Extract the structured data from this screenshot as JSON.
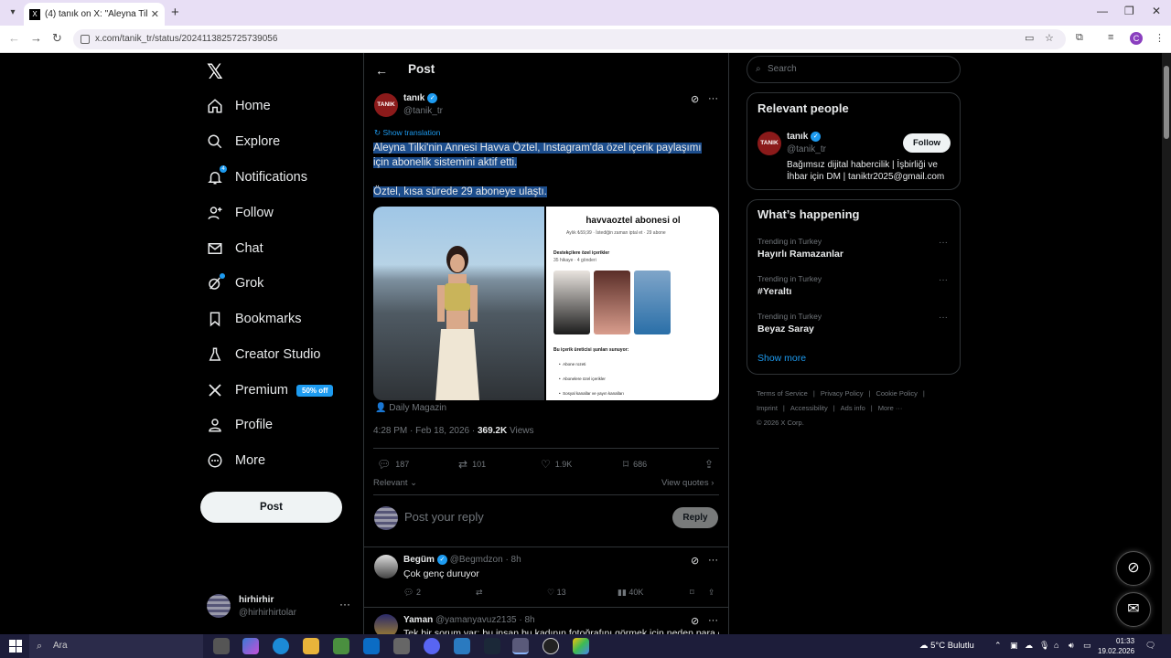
{
  "browser": {
    "tab_title": "(4) tanık on X: \"Aleyna Tilki'nin",
    "url": "x.com/tanik_tr/status/2024113825725739056"
  },
  "nav": {
    "items": [
      {
        "label": "Home",
        "icon": "home-icon"
      },
      {
        "label": "Explore",
        "icon": "search-icon"
      },
      {
        "label": "Notifications",
        "icon": "bell-icon",
        "badge": "4"
      },
      {
        "label": "Follow",
        "icon": "add-person-icon"
      },
      {
        "label": "Chat",
        "icon": "mail-icon"
      },
      {
        "label": "Grok",
        "icon": "grok-icon"
      },
      {
        "label": "Bookmarks",
        "icon": "bookmark-icon"
      },
      {
        "label": "Creator Studio",
        "icon": "creator-icon"
      },
      {
        "label": "Premium",
        "icon": "x-icon",
        "promo": "50% off"
      },
      {
        "label": "Profile",
        "icon": "person-icon"
      },
      {
        "label": "More",
        "icon": "more-circle-icon"
      }
    ],
    "post_button": "Post",
    "account_name": "hirhirhir",
    "account_handle": "@hirhirhirtolar"
  },
  "main": {
    "header": "Post",
    "author": {
      "avatar_text": "TANIK",
      "name": "tanık",
      "handle": "@tanik_tr"
    },
    "show_translation": "Show translation",
    "text_line1": "Aleyna Tilki'nin Annesi Havva Öztel, Instagram'da özel içerik paylaşımı için abonelik sistemini aktif etti.",
    "text_line2": "Öztel, kısa sürede 29 aboneye ulaştı.",
    "media": {
      "title": "havvaoztel abonesi ol",
      "subtitle": "Aylık ₺59,99 · İstediğin zaman iptal et · 29 abone",
      "section": "Destekçilere özel içerikler",
      "section_sub": "35 hikaye · 4 gönderi",
      "offers_title": "Bu içerik üreticisi şunları sunuyor:",
      "offers": [
        "Abone rozeti",
        "Abonelere özel içerikler",
        "Sosyal kanallar ve yayın kanalları"
      ]
    },
    "media_caption": "Daily Magazin",
    "time": "4:28 PM · Feb 18, 2026 · ",
    "views_count": "369.2K",
    "views_label": " Views",
    "stats": {
      "replies": "187",
      "reposts": "101",
      "likes": "1.9K",
      "bookmarks": "686"
    },
    "relevant": "Relevant",
    "view_quotes": "View quotes",
    "reply_placeholder": "Post your reply",
    "reply_button": "Reply",
    "comments": [
      {
        "name": "Begüm",
        "handle": "@Begmdzon",
        "time": "· 8h",
        "text": "Çok genç duruyor",
        "replies": "2",
        "likes": "13",
        "views": "40K"
      },
      {
        "name": "Yaman",
        "handle": "@yamanyavuz2135",
        "time": "· 8h",
        "text": "Tek bir sorum var: bu insan bu kadının fotoğrafını görmek için neden para öder?"
      }
    ]
  },
  "right": {
    "search_placeholder": "Search",
    "relevant_title": "Relevant people",
    "person": {
      "avatar_text": "TANIK",
      "name": "tanık",
      "handle": "@tanik_tr",
      "follow": "Follow",
      "bio": "Bağımsız dijital habercilik | İşbirliği ve İhbar için DM | taniktr2025@gmail.com"
    },
    "happening_title": "What’s happening",
    "trends": [
      {
        "category": "Trending in Turkey",
        "name": "Hayırlı Ramazanlar"
      },
      {
        "category": "Trending in Turkey",
        "name": "#Yeraltı"
      },
      {
        "category": "Trending in Turkey",
        "name": "Beyaz Saray"
      }
    ],
    "show_more": "Show more",
    "footer": [
      "Terms of Service",
      "|",
      "Privacy Policy",
      "|",
      "Cookie Policy",
      "|",
      "Imprint",
      "|",
      "Accessibility",
      "|",
      "Ads info",
      "|",
      "More ···",
      "© 2026 X Corp."
    ]
  },
  "taskbar": {
    "search": "Ara",
    "weather": "5°C  Bulutlu",
    "time": "01:33",
    "date": "19.02.2026"
  },
  "colors": {
    "accent": "#1d9bf0",
    "highlight": "#1c4d8c",
    "background": "#000000"
  }
}
